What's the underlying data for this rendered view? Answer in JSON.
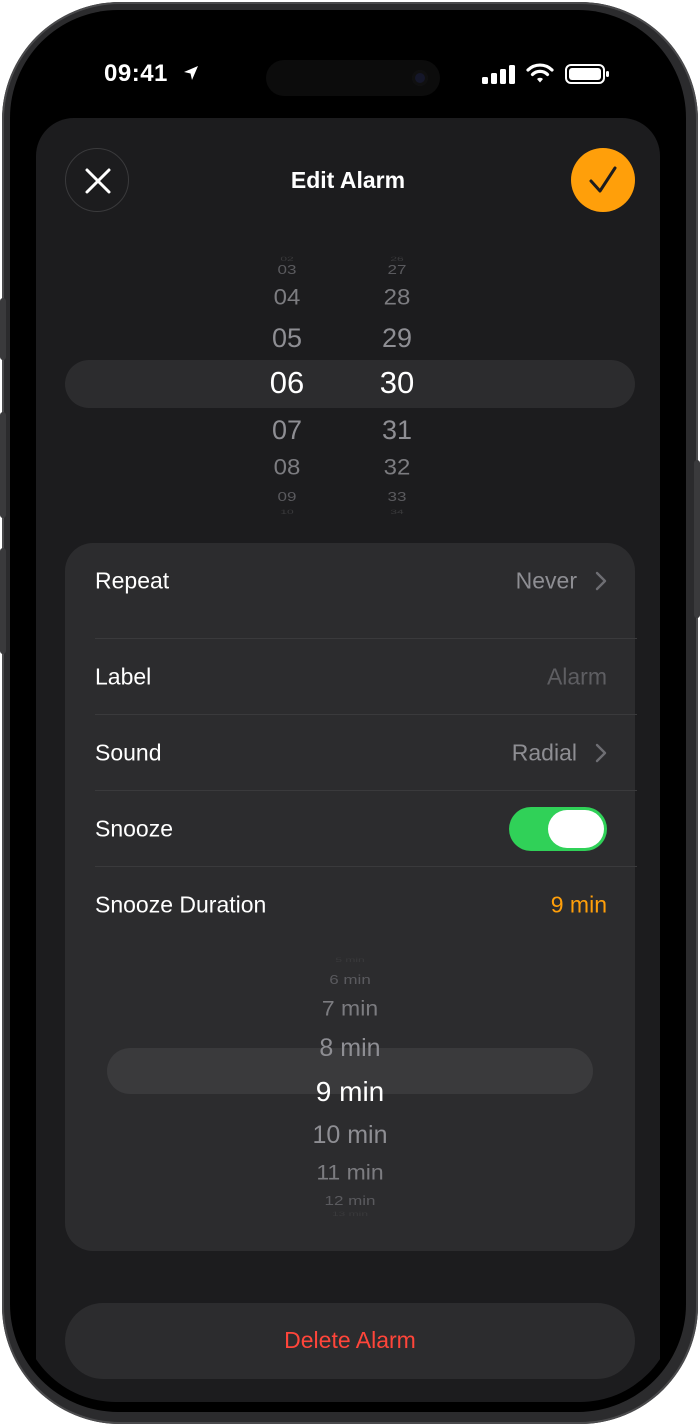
{
  "status_bar": {
    "time": "09:41"
  },
  "header": {
    "title": "Edit Alarm",
    "close_icon": "xmark-icon",
    "confirm_icon": "checkmark-icon",
    "accent": "#ff9f0a"
  },
  "time_picker": {
    "hours": [
      "02",
      "03",
      "04",
      "05",
      "06",
      "07",
      "08",
      "09",
      "10"
    ],
    "minutes": [
      "26",
      "27",
      "28",
      "29",
      "30",
      "31",
      "32",
      "33",
      "34"
    ],
    "selected_hour": "06",
    "selected_minute": "30"
  },
  "settings": {
    "repeat": {
      "label": "Repeat",
      "value": "Never"
    },
    "label": {
      "label": "Label",
      "placeholder": "Alarm"
    },
    "sound": {
      "label": "Sound",
      "value": "Radial"
    },
    "snooze": {
      "label": "Snooze",
      "enabled": true,
      "color": "#30d158"
    },
    "snooze_duration": {
      "label": "Snooze Duration",
      "value": "9 min"
    }
  },
  "snooze_picker": {
    "options": [
      "5 min",
      "6 min",
      "7 min",
      "8 min",
      "9 min",
      "10 min",
      "11 min",
      "12 min",
      "13 min"
    ],
    "selected": "9 min"
  },
  "delete": {
    "label": "Delete Alarm",
    "color": "#ff453a"
  }
}
